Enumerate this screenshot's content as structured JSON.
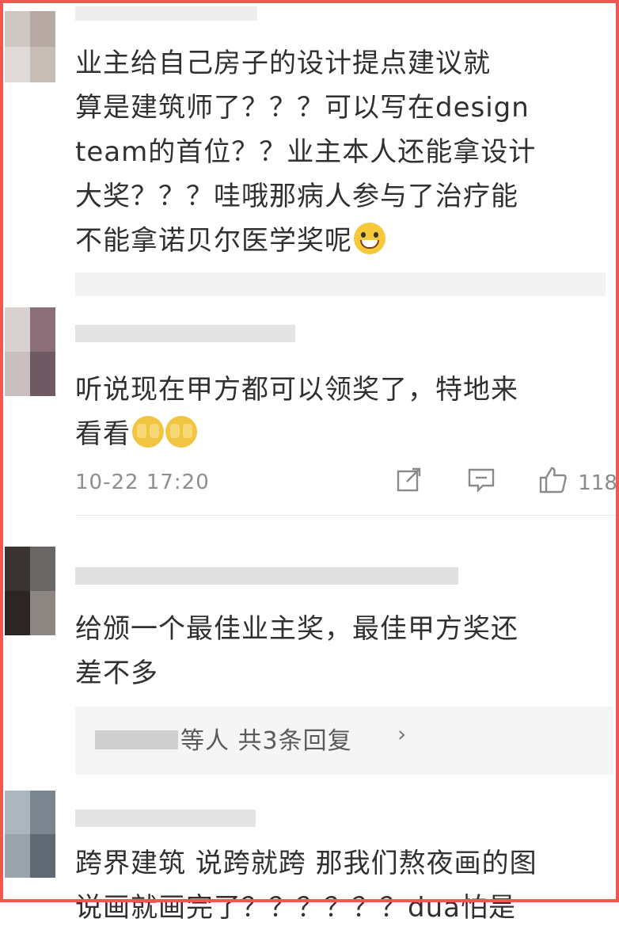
{
  "comments": [
    {
      "text": "业主给自己房子的设计提点建议就\n算是建筑师了？？？可以写在design\nteam的首位？？业主本人还能拿设计\n大奖？？？哇哦那病人参与了治疗能\n不能拿诺贝尔医学奖呢",
      "emoji": "grinning-emoji"
    },
    {
      "text": "听说现在甲方都可以领奖了，特地来\n看看",
      "time": "10-22 17:20",
      "like_count": "118"
    },
    {
      "text": "给颁一个最佳业主奖，最佳甲方奖还\n差不多",
      "reply_summary": "等人  共3条回复",
      "reply_chevron": "›"
    },
    {
      "text": "跨界建筑 说跨就跨 那我们熬夜画的图\n说画就画完了？？？？？？dua怕是"
    }
  ],
  "icons": {
    "share": "share-icon",
    "comment": "comment-icon",
    "like": "thumbs-up-icon"
  },
  "colors": {
    "frame": "#f0574f",
    "text": "#303030",
    "meta": "#8e8e8e"
  }
}
